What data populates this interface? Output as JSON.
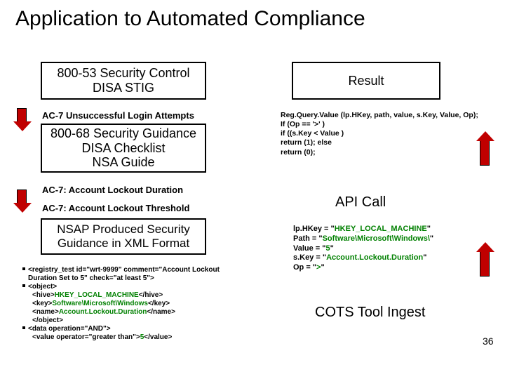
{
  "title": "Application to Automated Compliance",
  "left": {
    "box1": "800-53 Security Control\nDISA STIG",
    "label1": "AC-7 Unsuccessful Login Attempts",
    "box2": "800-68 Security Guidance\nDISA Checklist\nNSA Guide",
    "label2a": "AC-7: Account Lockout Duration",
    "label2b": "AC-7: Account Lockout Threshold",
    "box3": "NSAP Produced Security\nGuidance in XML Format",
    "xml": {
      "l1a": "<registry_test id=\"wrt-9999\" comment=\"Account Lockout",
      "l1b": "Duration Set to 5\" check=\"at least 5\">",
      "l2": "<object>",
      "l3": "<hive>HKEY_LOCAL_MACHINE</hive>",
      "l4": "<key>Software\\Microsoft\\Windows</key>",
      "l5": "<name>Account.Lockout.Duration</name>",
      "l6": "</object>",
      "l7": "<data operation=\"AND\">",
      "l8a": "<value operator=\"greater than\">",
      "l8b": "5",
      "l8c": "</value>"
    }
  },
  "right": {
    "box_result": "Result",
    "code": {
      "l1": "Reg.Query.Value (lp.HKey, path, value, s.Key, Value, Op);",
      "l2": "If (Op == '>' )",
      "l3": "if ((s.Key < Value )",
      "l4": "return (1); else",
      "l5": "return (0);"
    },
    "api_call": "API Call",
    "assign": {
      "l1a": "lp.HKey = \"",
      "l1b": "HKEY_LOCAL_MACHINE",
      "l1c": "\"",
      "l2a": "Path = \"",
      "l2b": "Software\\Microsoft\\Windows\\",
      "l2c": "\"",
      "l3a": "Value = \"",
      "l3b": "5",
      "l3c": "\"",
      "l4a": "s.Key = \"",
      "l4b": "Account.Lockout.Duration",
      "l4c": "\"",
      "l5a": "Op = \"",
      "l5b": ">",
      "l5c": "\""
    },
    "cots": "COTS Tool Ingest"
  },
  "page": "36"
}
